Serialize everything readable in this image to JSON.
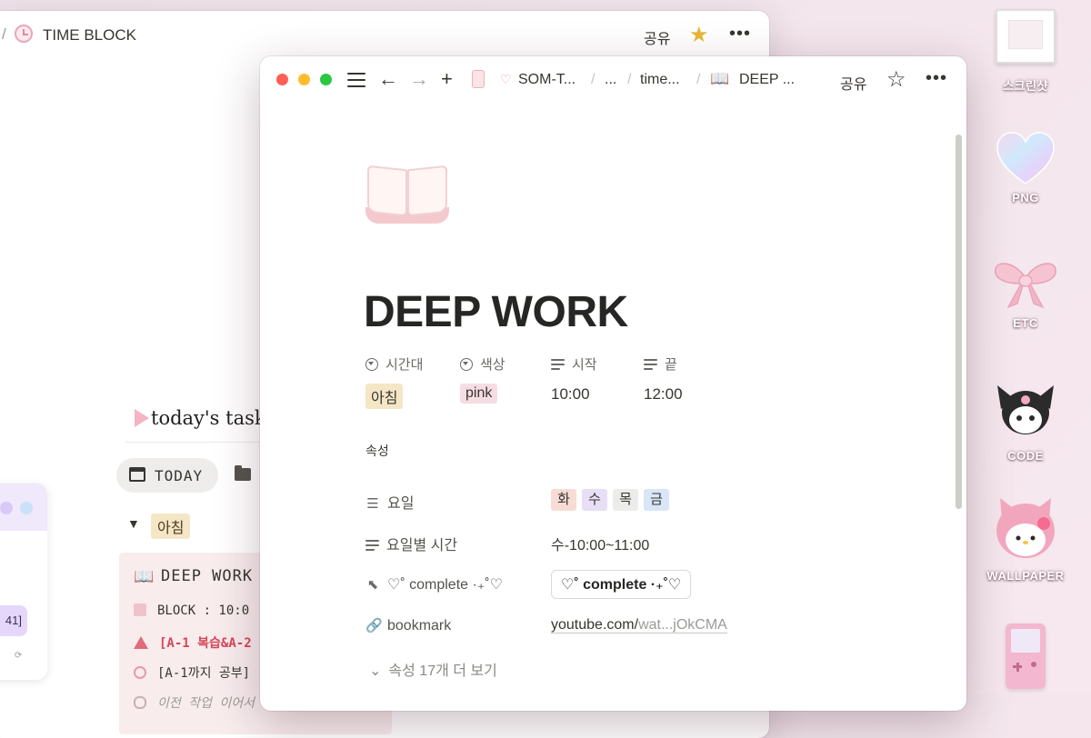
{
  "back_window": {
    "title": "TIME BLOCK",
    "share": "공유",
    "more": "•••",
    "tasks_heading": "today's task",
    "today_button": "TODAY",
    "group_label": "아침",
    "card": {
      "title": "DEEP WORK",
      "line1": "BLOCK : 10:0",
      "line2": "[A-1 복습&A-2",
      "line3": "[A-1까지 공부]",
      "line4": "이전 작업 이어서"
    },
    "mini_widget": {
      "badge": "41]",
      "small": "⟳"
    }
  },
  "front_window": {
    "breadcrumbs": {
      "item1": "SOM-T...",
      "item2": "...",
      "item3": "time...",
      "item4": "DEEP ..."
    },
    "share": "공유",
    "more": "•••",
    "page_title": "DEEP WORK",
    "properties_top": [
      {
        "name": "시간대",
        "value": "아침",
        "tag_color": "#f5e6c6"
      },
      {
        "name": "색상",
        "value": "pink",
        "tag_color": "#f6dde4"
      },
      {
        "name": "시작",
        "value": "10:00"
      },
      {
        "name": "끝",
        "value": "12:00"
      }
    ],
    "section_label": "속성",
    "rows": {
      "weekday_label": "요일",
      "weekdays": [
        {
          "text": "화",
          "color": "#f7dcd6"
        },
        {
          "text": "수",
          "color": "#e8def6"
        },
        {
          "text": "목",
          "color": "#ececea"
        },
        {
          "text": "금",
          "color": "#d8e6f7"
        }
      ],
      "time_label": "요일별 시간",
      "time_value": "수-10:00~11:00",
      "complete_label": "♡˚ complete ·₊˚♡",
      "complete_value": "♡˚ complete ·₊˚♡",
      "bookmark_label": "bookmark",
      "bookmark_host": "youtube.com/",
      "bookmark_rest": "wat...jOkCMA",
      "more_props": "속성 17개 더 보기"
    }
  },
  "desktop": {
    "icons": [
      {
        "label": "스크린샷"
      },
      {
        "label": "PNG"
      },
      {
        "label": "ETC"
      },
      {
        "label": "CODE"
      },
      {
        "label": "WALLPAPER"
      }
    ]
  },
  "colors": {
    "close": "#ff5f57",
    "minimize": "#febc2e",
    "zoom": "#28c840",
    "accent_star": "#e8b73a"
  }
}
